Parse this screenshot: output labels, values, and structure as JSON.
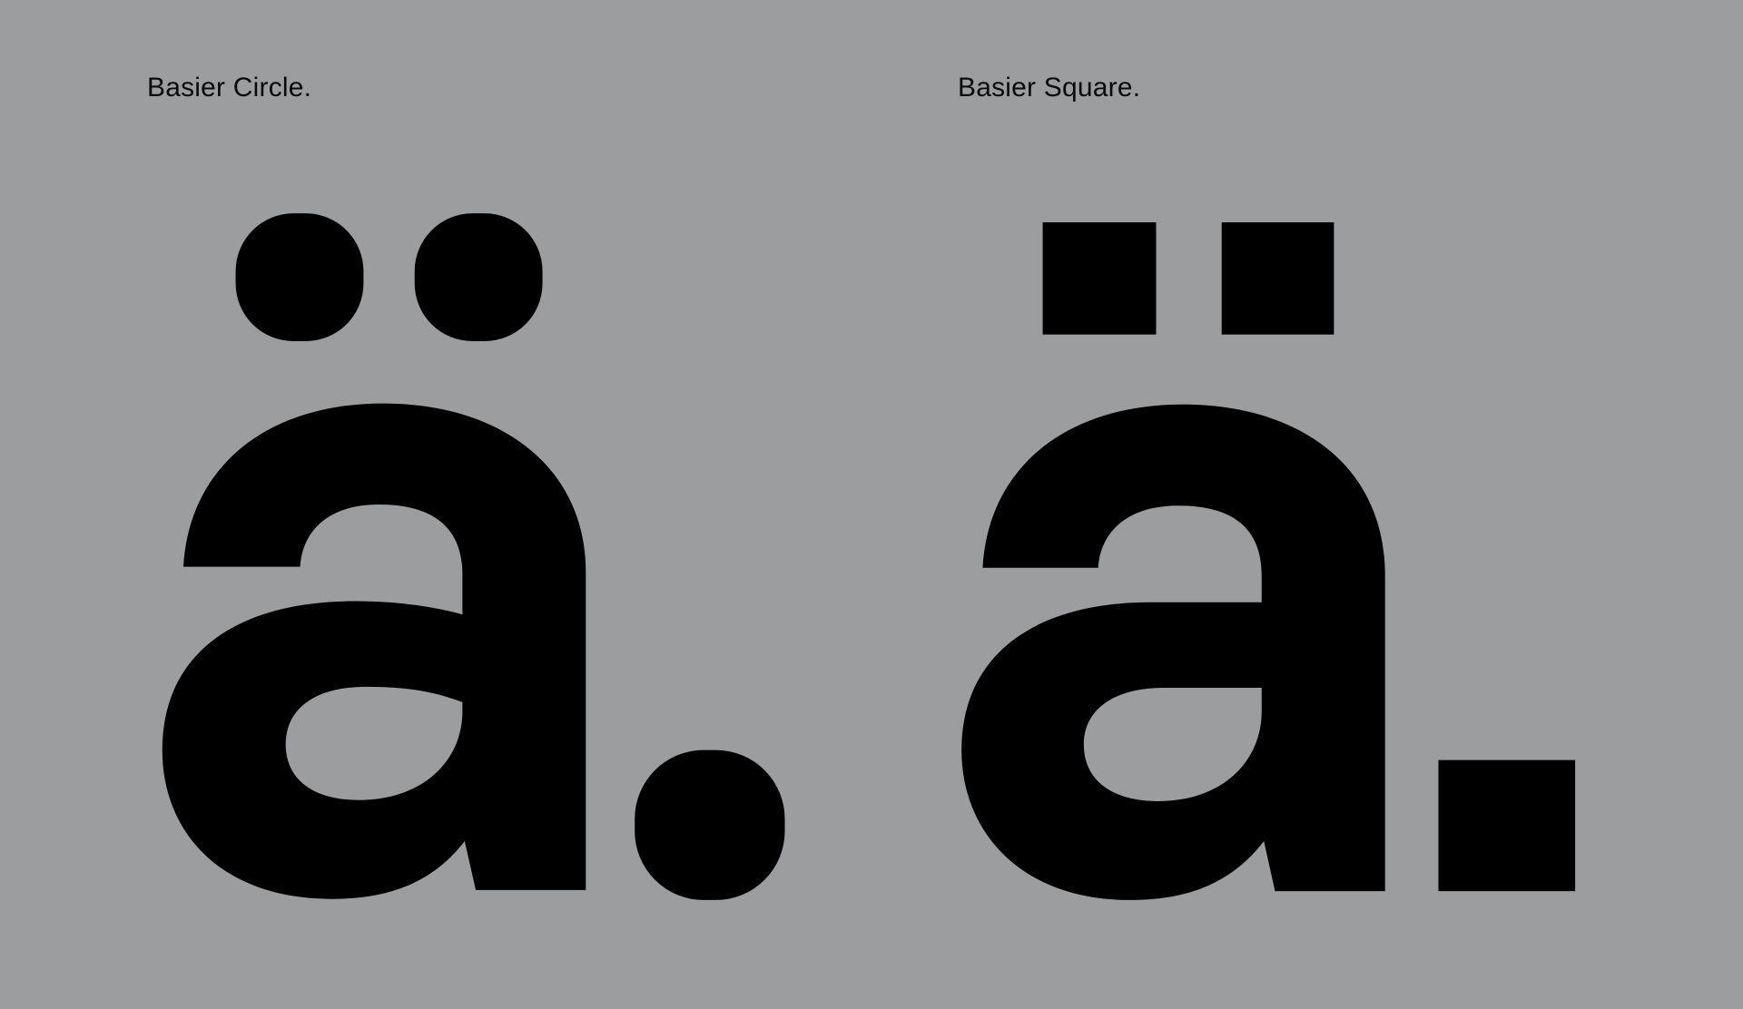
{
  "specimens": [
    {
      "label": "Basier Circle.",
      "glyph": "ä.",
      "style": "round"
    },
    {
      "label": "Basier Square.",
      "glyph": "ä.",
      "style": "square"
    }
  ],
  "colors": {
    "background": "#9c9d9f",
    "ink": "#000000"
  }
}
